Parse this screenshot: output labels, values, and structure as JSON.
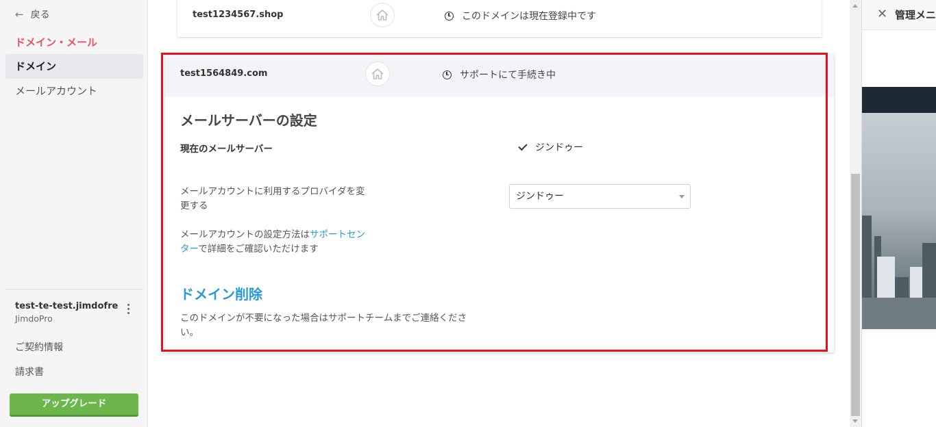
{
  "sidebar": {
    "back_label": "戻る",
    "section_title": "ドメイン・メール",
    "items": [
      {
        "label": "ドメイン",
        "active": true
      },
      {
        "label": "メールアカウント",
        "active": false
      }
    ],
    "site_name": "test-te-test.jimdofree....",
    "site_plan": "JimdoPro",
    "links": [
      "ご契約情報",
      "請求書"
    ],
    "upgrade_label": "アップグレード",
    "accent_color": "#e5536a",
    "upgrade_color": "#6bb74c"
  },
  "domains": [
    {
      "name": "test1234567.shop",
      "status": "このドメインは現在登録中です",
      "icon": "home-icon",
      "status_icon": "clock-icon"
    },
    {
      "name": "test1564849.com",
      "status": "サポートにて手続き中",
      "icon": "home-icon",
      "status_icon": "clock-icon"
    }
  ],
  "mail_settings": {
    "title": "メールサーバーの設定",
    "current_label": "現在のメールサーバー",
    "current_value": "ジンドゥー",
    "provider_label_line1": "メールアカウントに利用するプロバイダを変",
    "provider_label_line2": "更する",
    "provider_selected": "ジンドゥー",
    "info_prefix": "メールアカウントの設定方法は",
    "info_link_line1": "サポートセン",
    "info_link_line2": "ター",
    "info_suffix": "で詳細をご確認いただけます"
  },
  "delete_section": {
    "title": "ドメイン削除",
    "text_line1": "このドメインが不要になった場合はサポートチームまでご連絡くださ",
    "text_line2": "い。",
    "title_color": "#2a9ad6"
  },
  "right_panel": {
    "title": "管理メニュー"
  },
  "highlight_color": "#e8101a"
}
